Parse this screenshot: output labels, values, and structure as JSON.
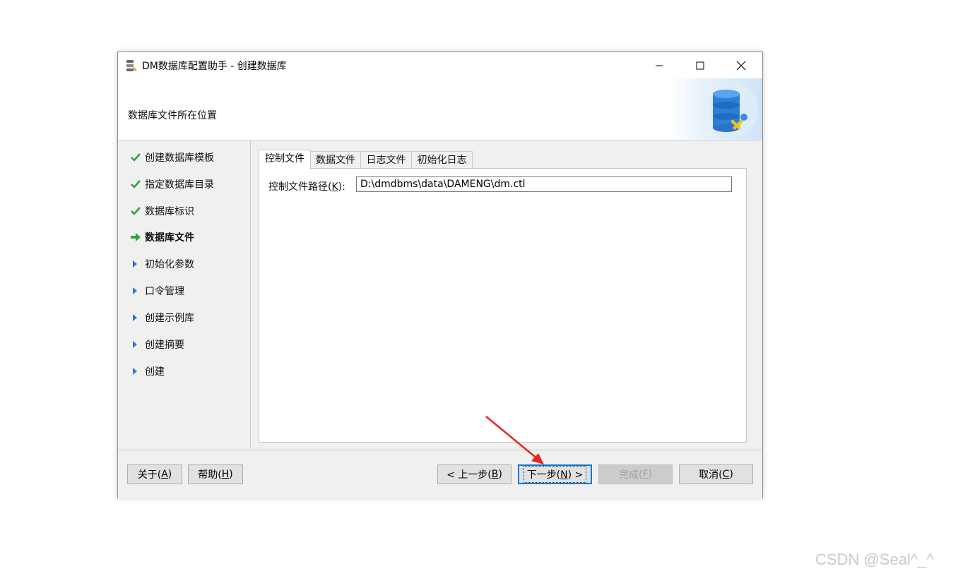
{
  "window": {
    "title": "DM数据库配置助手 - 创建数据库",
    "controls": [
      "minimize-icon",
      "maximize-icon",
      "close-icon"
    ]
  },
  "header": {
    "title": "数据库文件所在位置",
    "art_icon": "database-tools-icon"
  },
  "sidebar": {
    "steps": [
      {
        "label": "创建数据库模板",
        "status": "done"
      },
      {
        "label": "指定数据库目录",
        "status": "done"
      },
      {
        "label": "数据库标识",
        "status": "done"
      },
      {
        "label": "数据库文件",
        "status": "current"
      },
      {
        "label": "初始化参数",
        "status": "pending"
      },
      {
        "label": "口令管理",
        "status": "pending"
      },
      {
        "label": "创建示例库",
        "status": "pending"
      },
      {
        "label": "创建摘要",
        "status": "pending"
      },
      {
        "label": "创建",
        "status": "pending"
      }
    ]
  },
  "tabs": [
    {
      "label": "控制文件",
      "active": true
    },
    {
      "label": "数据文件",
      "active": false
    },
    {
      "label": "日志文件",
      "active": false
    },
    {
      "label": "初始化日志",
      "active": false
    }
  ],
  "control_file": {
    "label_prefix": "控制文件路径(",
    "label_key": "K",
    "label_suffix": "):",
    "value": "D:\\dmdbms\\data\\DAMENG\\dm.ctl"
  },
  "footer": {
    "about": {
      "prefix": "关于(",
      "key": "A",
      "suffix": ")"
    },
    "help": {
      "prefix": "帮助(",
      "key": "H",
      "suffix": ")"
    },
    "back": {
      "prefix": "< 上一步(",
      "key": "B",
      "suffix": ")"
    },
    "next": {
      "prefix": "下一步(",
      "key": "N",
      "suffix": ") >"
    },
    "finish": {
      "prefix": "完成(",
      "key": "F",
      "suffix": ")"
    },
    "cancel": {
      "prefix": "取消(",
      "key": "C",
      "suffix": ")"
    }
  },
  "colors": {
    "done_check": "#2ea043",
    "current_arrow": "#2ea043",
    "pending_triangle": "#2b7cd3",
    "annotation_arrow": "#e8261f",
    "default_button_border": "#0078d7"
  },
  "watermark": "CSDN @Seal^_^"
}
